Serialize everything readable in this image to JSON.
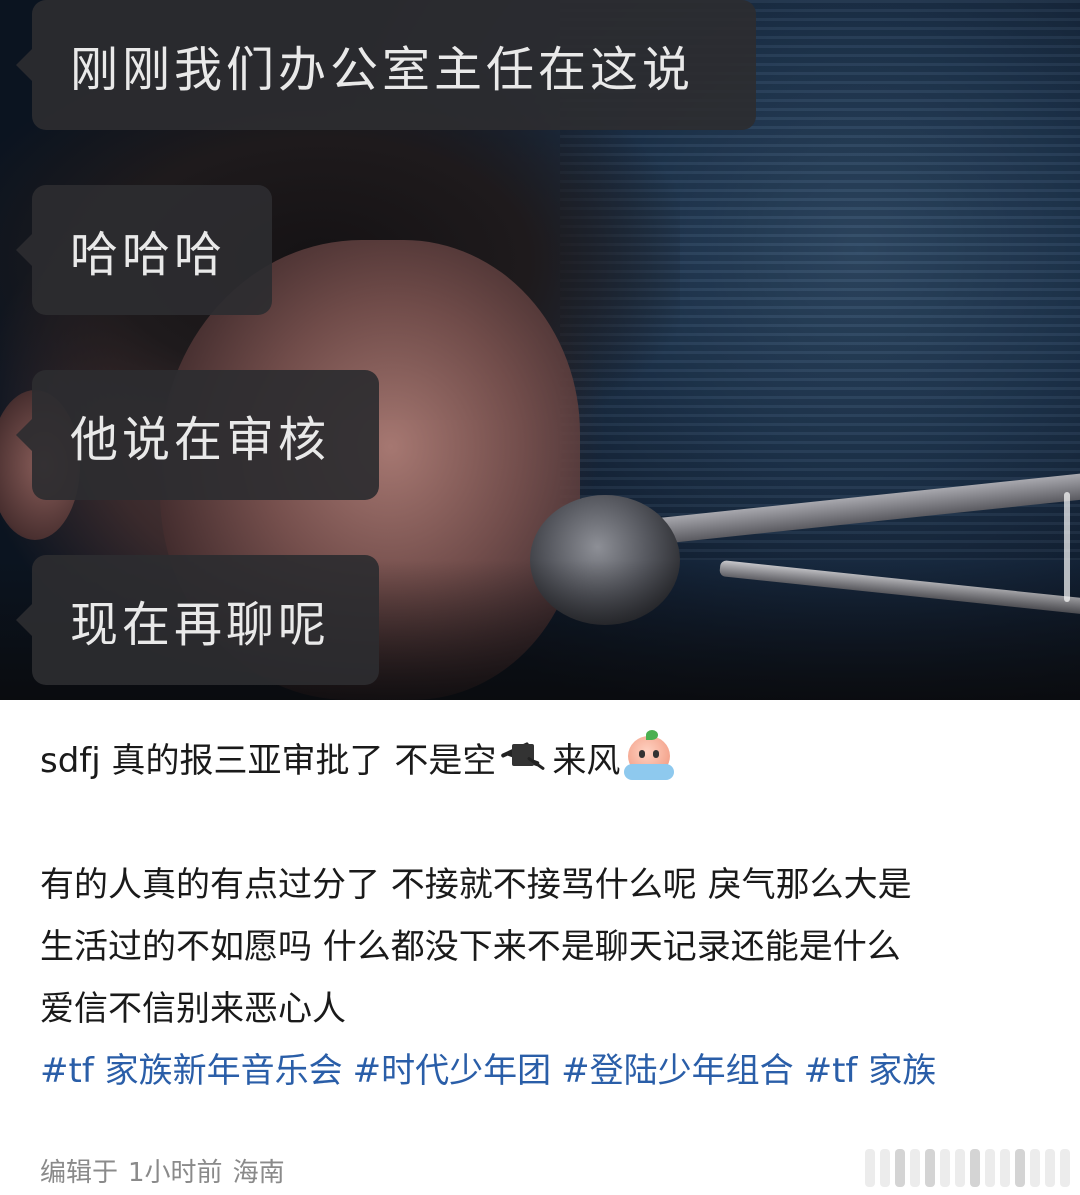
{
  "chat": {
    "messages": [
      "刚刚我们办公室主任在这说",
      "哈哈哈",
      "他说在审核",
      "现在再聊呢"
    ]
  },
  "post": {
    "line1_pre": "sdfj 真的报三亚审批了 不是空",
    "line1_post": "来风",
    "emoji": "crying-peach-emoji",
    "body_lines": [
      "有的人真的有点过分了 不接就不接骂什么呢 戾气那么大是",
      "生活过的不如愿吗 什么都没下来不是聊天记录还能是什么",
      "爱信不信别来恶心人"
    ],
    "hashtags": [
      "#tf 家族新年音乐会",
      "#时代少年团",
      "#登陆少年组合",
      "#tf 家族"
    ]
  },
  "footer": {
    "edited": "编辑于",
    "time": "1小时前",
    "location": "海南"
  },
  "colors": {
    "bubble_bg": "#2d2d30",
    "hashtag": "#2a5ea8",
    "footer_text": "#8a8a8a"
  }
}
